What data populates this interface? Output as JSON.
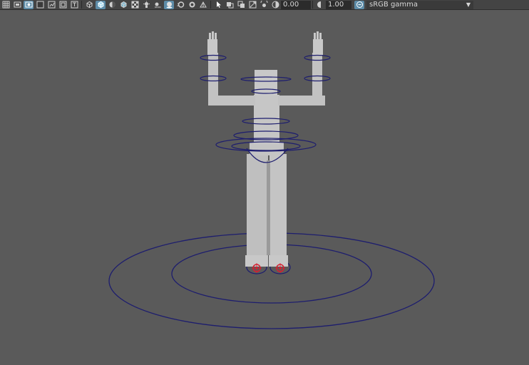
{
  "toolbar": {
    "exposure_value": "0.00",
    "gamma_value": "1.00",
    "color_space": "sRGB gamma",
    "icons_left": [
      "grid-icon",
      "film-gate-icon",
      "resolution-gate-icon",
      "gate-mask-icon",
      "field-chart-icon",
      "safe-action-icon",
      "safe-title-icon"
    ],
    "icons_shading": [
      "wireframe-cube-icon",
      "smooth-shade-icon",
      "shade-default-material-icon",
      "wireframe-on-shaded-icon",
      "textured-icon",
      "use-lights-icon",
      "shadows-icon",
      "ambient-occlusion-icon",
      "motion-blur-icon",
      "multisample-aa-icon",
      "depth-of-field-icon"
    ],
    "icons_isolate": [
      "isolate-select-icon",
      "xray-icon",
      "xray-active-components-icon",
      "xray-joints-icon",
      "backface-culling-icon"
    ]
  },
  "viewport": {
    "background": "#5a5a5a",
    "model_color": "#c4c4c4",
    "control_curve_color": "#1d1d6e",
    "locator_color": "#d42030"
  }
}
